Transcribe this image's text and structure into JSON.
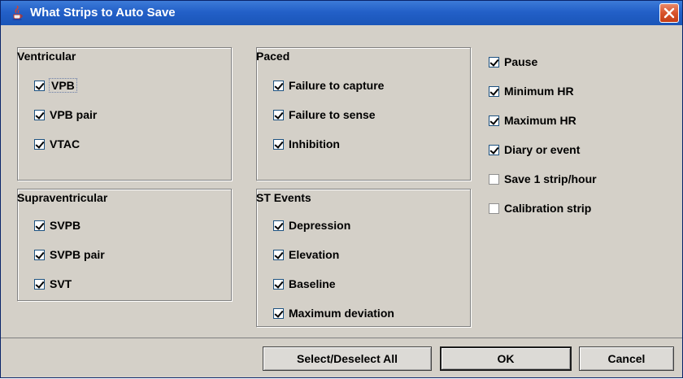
{
  "window": {
    "title": "What Strips to Auto Save",
    "icon": "java-cup-icon",
    "close_icon": "close-icon"
  },
  "groups": {
    "ventricular": {
      "title": "Ventricular",
      "items": [
        {
          "label": "VPB",
          "checked": true
        },
        {
          "label": "VPB pair",
          "checked": true
        },
        {
          "label": "VTAC",
          "checked": true
        }
      ]
    },
    "paced": {
      "title": "Paced",
      "items": [
        {
          "label": "Failure to capture",
          "checked": true
        },
        {
          "label": "Failure to sense",
          "checked": true
        },
        {
          "label": "Inhibition",
          "checked": true
        }
      ]
    },
    "supraventricular": {
      "title": "Supraventricular",
      "items": [
        {
          "label": "SVPB",
          "checked": true
        },
        {
          "label": "SVPB pair",
          "checked": true
        },
        {
          "label": "SVT",
          "checked": true
        }
      ]
    },
    "st_events": {
      "title": "ST Events",
      "items": [
        {
          "label": "Depression",
          "checked": true
        },
        {
          "label": "Elevation",
          "checked": true
        },
        {
          "label": "Baseline",
          "checked": true
        },
        {
          "label": "Maximum deviation",
          "checked": true
        }
      ]
    }
  },
  "options": [
    {
      "label": "Pause",
      "checked": true
    },
    {
      "label": "Minimum HR",
      "checked": true
    },
    {
      "label": "Maximum HR",
      "checked": true
    },
    {
      "label": "Diary or event",
      "checked": true
    },
    {
      "label": "Save 1 strip/hour",
      "checked": false
    },
    {
      "label": "Calibration strip",
      "checked": false
    }
  ],
  "buttons": {
    "select_all": "Select/Deselect All",
    "ok": "OK",
    "cancel": "Cancel"
  }
}
